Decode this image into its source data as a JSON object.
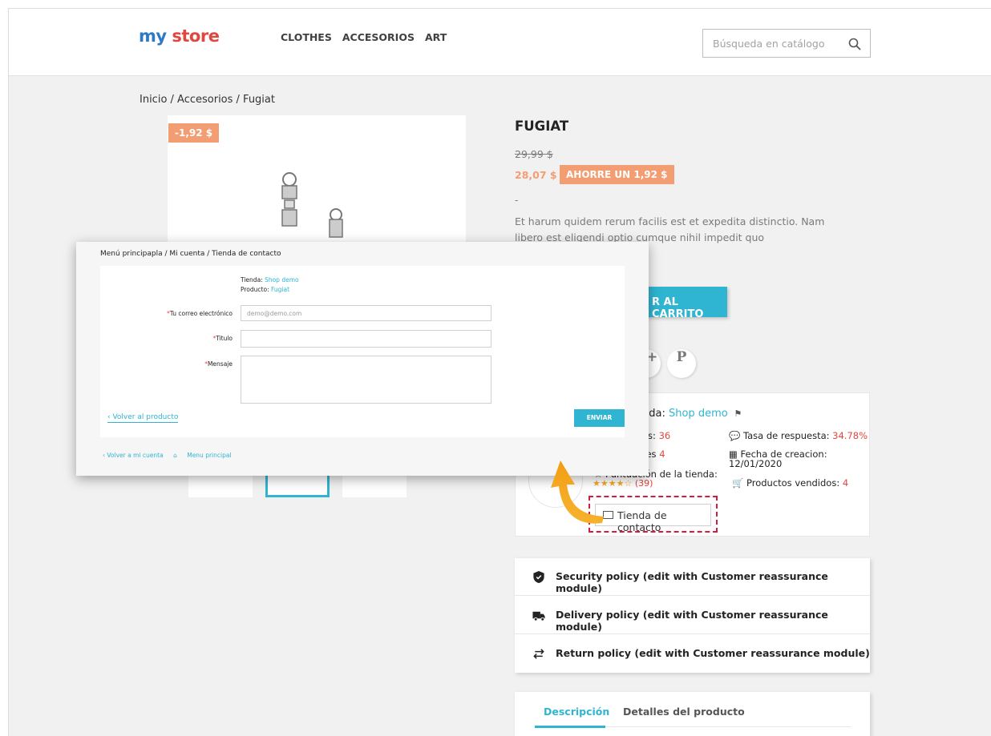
{
  "header": {
    "logo": {
      "my": "my",
      "store": "store"
    },
    "nav": [
      "CLOTHES",
      "ACCESORIOS",
      "ART"
    ],
    "search_placeholder": "Búsqueda en catálogo"
  },
  "breadcrumb": "Inicio / Accesorios / Fugiat",
  "product": {
    "discount_badge": "-1,92 $",
    "title": "FUGIAT",
    "old_price": "29,99 $",
    "new_price": "28,07 $",
    "save_badge": "AHORRE UN 1,92 $",
    "dash": "-",
    "description": "Et harum quidem rerum facilis est et expedita distinctio. Nam libero est eligendi optio cumque nihil impedit quo",
    "cart_label": "R AL CARRITO",
    "social": [
      "G+",
      "P"
    ]
  },
  "seller": {
    "tienda_prefix": "nda: ",
    "tienda_name": "Shop demo",
    "stat_left_1_label": "os: ",
    "stat_left_1_value": "36",
    "stat_left_2_label": "res ",
    "stat_left_2_value": "4",
    "response_label": "Tasa de respuesta: ",
    "response_value": "34.78%",
    "creation_label": "Fecha de creacion:",
    "creation_value": "12/01/2020",
    "rating_label": "Puntuación de la tienda:",
    "rating_stars": "★★★★☆",
    "rating_count": "(39)",
    "sold_label": "Productos vendidos: ",
    "sold_value": "4",
    "contact_button": "Tienda de contacto"
  },
  "policies": [
    {
      "icon": "shield-icon",
      "label": "Security policy (edit with Customer reassurance module)"
    },
    {
      "icon": "truck-icon",
      "label": "Delivery policy (edit with Customer reassurance module)"
    },
    {
      "icon": "arrows-icon",
      "label": "Return policy (edit with Customer reassurance module)"
    }
  ],
  "tabs": [
    "Descripción",
    "Detalles del producto"
  ],
  "overlay": {
    "breadcrumb": "Menú principapla / Mi cuenta / Tienda de contacto",
    "tienda_label": "Tienda: ",
    "tienda_value": "Shop demo",
    "producto_label": "Producto: ",
    "producto_value": "Fugiat",
    "required_mark": "*",
    "email_label": "Tu correo electrónico",
    "email_placeholder": "demo@demo.com",
    "titulo_label": "Titulo",
    "mensaje_label": "Mensaje",
    "back_label": "‹ Volver al producto",
    "send_label": "ENVIAR",
    "bottom_link_account": "‹ Volver a mi cuenta",
    "bottom_link_home": "Menu principal"
  },
  "colors": {
    "accent": "#2fb5d2",
    "price": "#f39d72",
    "red": "#e2473f",
    "highlight_arrow": "#f5a623",
    "dashed_box": "#d71a3f"
  }
}
